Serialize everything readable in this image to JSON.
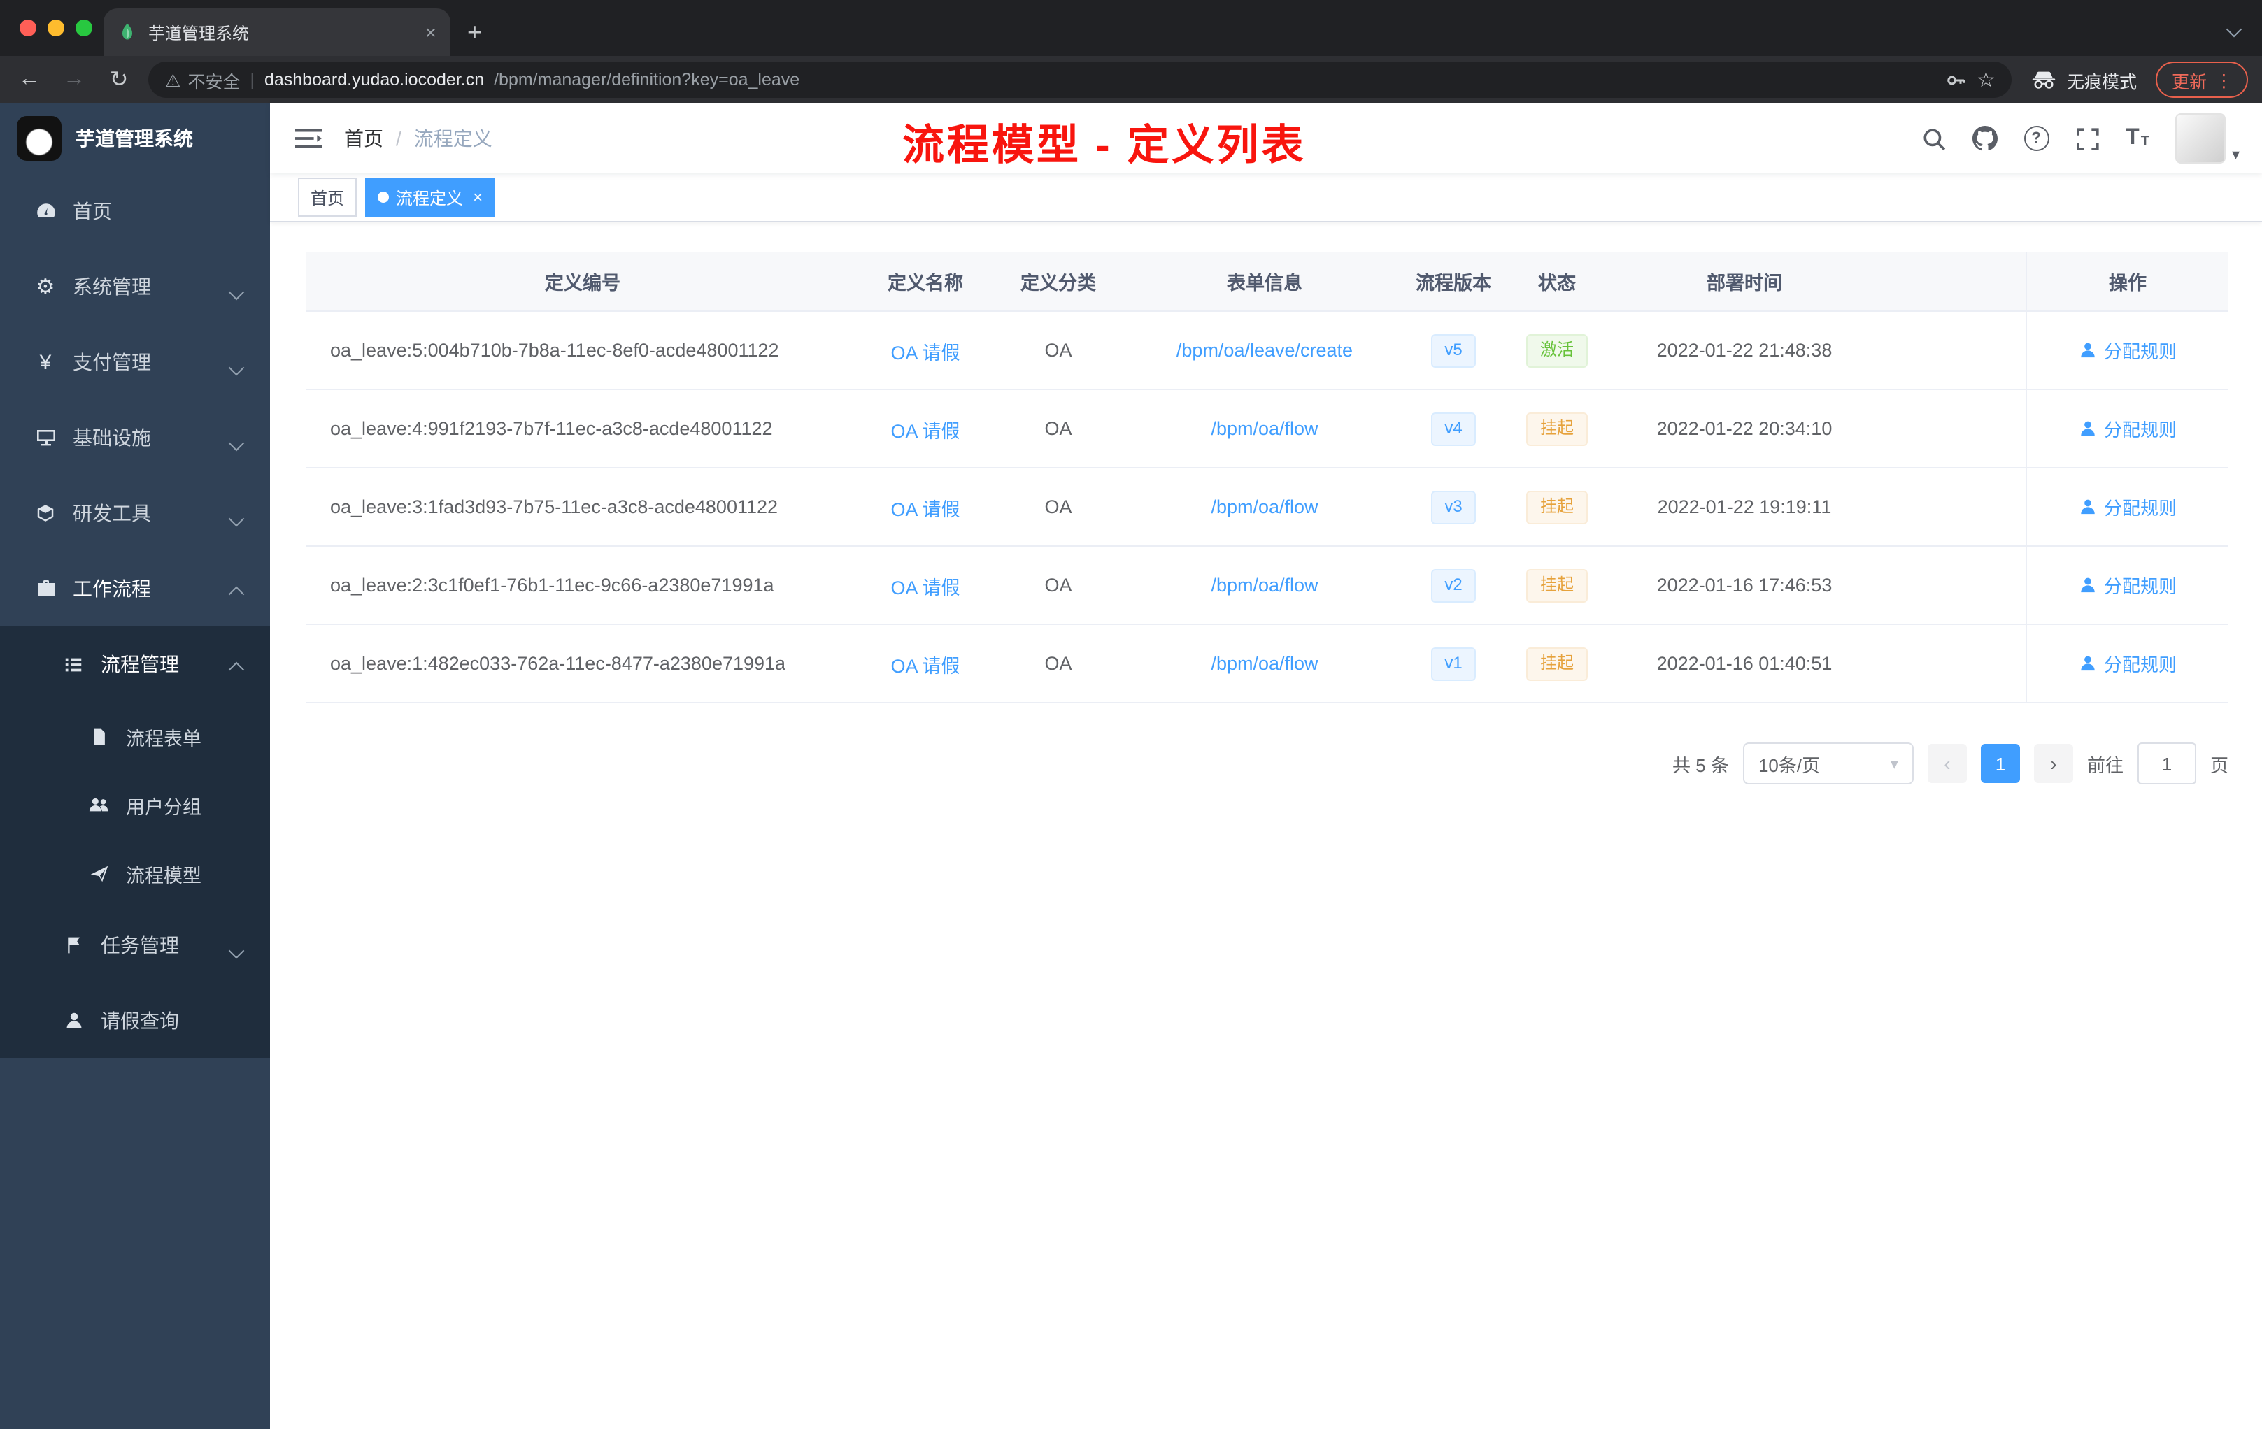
{
  "browser": {
    "tab": {
      "title": "芋道管理系统"
    },
    "address": {
      "security_label": "不安全",
      "host": "dashboard.yudao.iocoder.cn",
      "path": "/bpm/manager/definition?key=oa_leave"
    },
    "incognito_label": "无痕模式",
    "update_label": "更新"
  },
  "sidebar": {
    "app_title": "芋道管理系统",
    "items": [
      {
        "label": "首页"
      },
      {
        "label": "系统管理"
      },
      {
        "label": "支付管理"
      },
      {
        "label": "基础设施"
      },
      {
        "label": "研发工具"
      },
      {
        "label": "工作流程"
      }
    ],
    "process_mgmt": {
      "label": "流程管理",
      "children": [
        {
          "label": "流程表单"
        },
        {
          "label": "用户分组"
        },
        {
          "label": "流程模型"
        }
      ]
    },
    "task_mgmt": {
      "label": "任务管理"
    },
    "leave_query": {
      "label": "请假查询"
    }
  },
  "header": {
    "breadcrumb": {
      "home": "首页",
      "separator": "/",
      "current": "流程定义"
    },
    "annotation": "流程模型 - 定义列表"
  },
  "tags": {
    "home": "首页",
    "active": "流程定义"
  },
  "table": {
    "columns": {
      "id": "定义编号",
      "name": "定义名称",
      "category": "定义分类",
      "form": "表单信息",
      "version": "流程版本",
      "status": "状态",
      "deploy_time": "部署时间",
      "actions": "操作"
    },
    "rows": [
      {
        "id": "oa_leave:5:004b710b-7b8a-11ec-8ef0-acde48001122",
        "name": "OA 请假",
        "category": "OA",
        "form": "/bpm/oa/leave/create",
        "version": "v5",
        "status": "激活",
        "status_type": "success",
        "time": "2022-01-22 21:48:38",
        "action": "分配规则"
      },
      {
        "id": "oa_leave:4:991f2193-7b7f-11ec-a3c8-acde48001122",
        "name": "OA 请假",
        "category": "OA",
        "form": "/bpm/oa/flow",
        "version": "v4",
        "status": "挂起",
        "status_type": "warning",
        "time": "2022-01-22 20:34:10",
        "action": "分配规则"
      },
      {
        "id": "oa_leave:3:1fad3d93-7b75-11ec-a3c8-acde48001122",
        "name": "OA 请假",
        "category": "OA",
        "form": "/bpm/oa/flow",
        "version": "v3",
        "status": "挂起",
        "status_type": "warning",
        "time": "2022-01-22 19:19:11",
        "action": "分配规则"
      },
      {
        "id": "oa_leave:2:3c1f0ef1-76b1-11ec-9c66-a2380e71991a",
        "name": "OA 请假",
        "category": "OA",
        "form": "/bpm/oa/flow",
        "version": "v2",
        "status": "挂起",
        "status_type": "warning",
        "time": "2022-01-16 17:46:53",
        "action": "分配规则"
      },
      {
        "id": "oa_leave:1:482ec033-762a-11ec-8477-a2380e71991a",
        "name": "OA 请假",
        "category": "OA",
        "form": "/bpm/oa/flow",
        "version": "v1",
        "status": "挂起",
        "status_type": "warning",
        "time": "2022-01-16 01:40:51",
        "action": "分配规则"
      }
    ]
  },
  "pagination": {
    "total": "共 5 条",
    "page_size": "10条/页",
    "page": "1",
    "goto_label": "前往",
    "goto_value": "1",
    "goto_unit": "页"
  },
  "icons": {
    "gear": "⚙",
    "yen": "¥",
    "warning": "⚠",
    "star": "☆",
    "back": "←",
    "forward": "→",
    "reload": "↻",
    "plus": "+",
    "close": "×",
    "more": "⋮",
    "caret": "▾",
    "prev": "‹",
    "next": "›",
    "question": "?",
    "divider": "|",
    "font_big": "T",
    "font_small": "T"
  },
  "colors": {
    "accent": "#409eff",
    "success": "#67c23a",
    "warning": "#e6a23c",
    "annotation_red": "#f8150e",
    "sidebar_bg": "#304156",
    "submenu_bg": "#1f2d3d"
  }
}
